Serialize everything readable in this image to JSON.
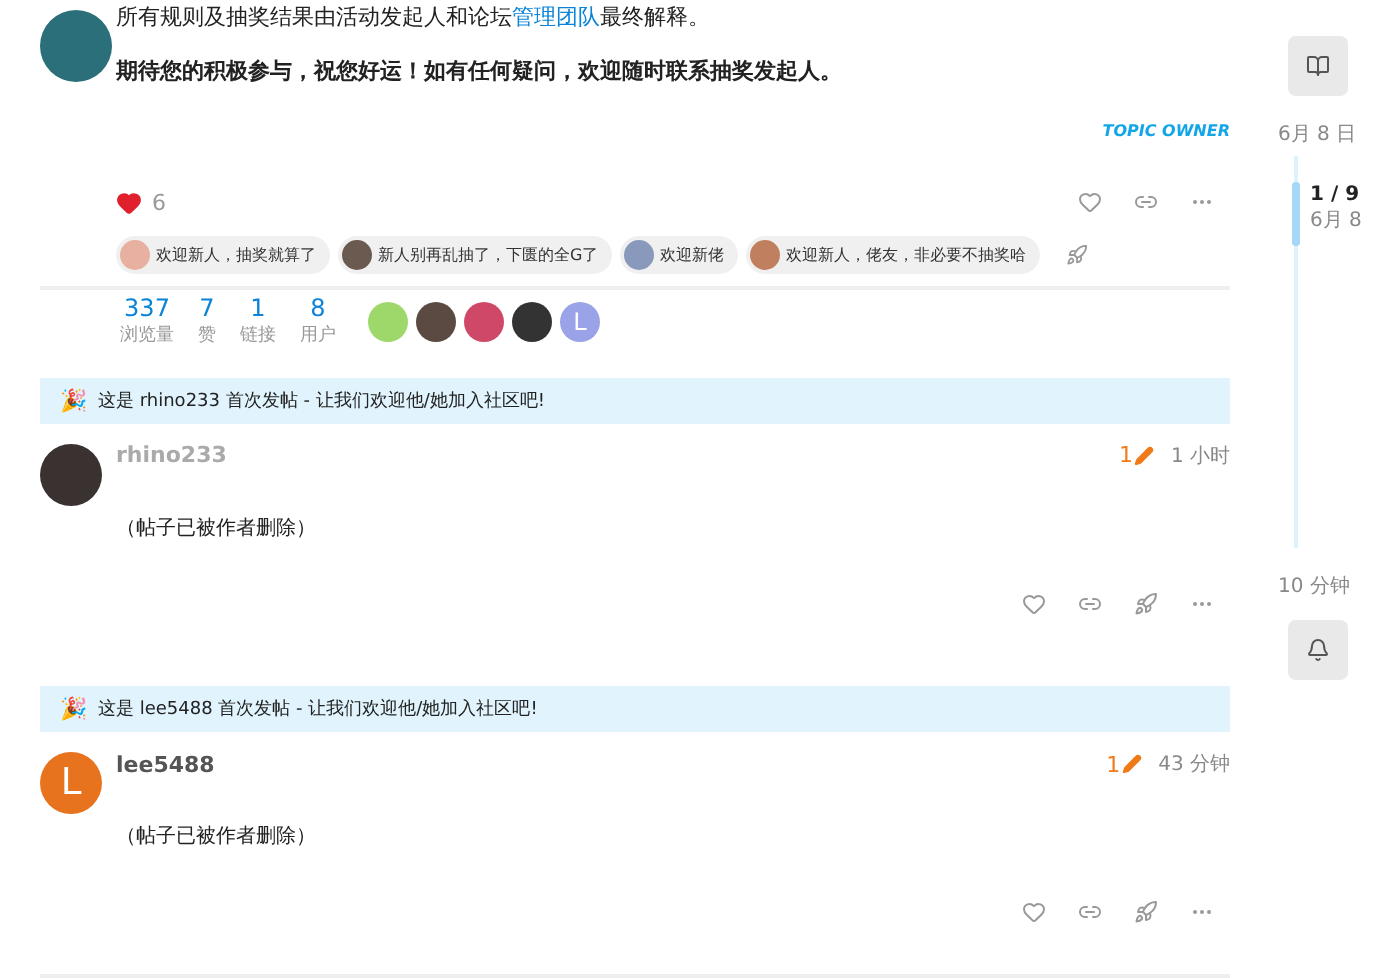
{
  "first_post": {
    "paragraph_1": {
      "before": "所有规则及抽奖结果由活动发起人和论坛",
      "link": "管理团队",
      "after": "最终解释。"
    },
    "paragraph_2": "期待您的积极参与，祝您好运！如有任何疑问，欢迎随时联系抽奖发起人。",
    "badge": "TOPIC OWNER",
    "likes": {
      "count": "6",
      "liked": true
    },
    "reactions": [
      {
        "text": "欢迎新人，抽奖就算了"
      },
      {
        "text": "新人别再乱抽了，下匮的全G了"
      },
      {
        "text": "欢迎新佬"
      },
      {
        "text": "欢迎新人，佬友，非必要不抽奖哈"
      }
    ]
  },
  "stats": [
    {
      "value": "337",
      "label": "浏览量"
    },
    {
      "value": "7",
      "label": "赞"
    },
    {
      "value": "1",
      "label": "链接"
    },
    {
      "value": "8",
      "label": "用户"
    }
  ],
  "participants": [
    {
      "kind": "image"
    },
    {
      "kind": "image"
    },
    {
      "kind": "image"
    },
    {
      "kind": "image"
    },
    {
      "kind": "letter",
      "letter": "L"
    }
  ],
  "posts": [
    {
      "banner_icon": "🎉",
      "banner": "这是 rhino233 首次发帖 - 让我们欢迎他/她加入社区吧!",
      "username": "rhino233",
      "deleted_look": true,
      "avatar": {
        "kind": "image"
      },
      "edits": "1",
      "time": "1 小时",
      "body": "（帖子已被作者删除）"
    },
    {
      "banner_icon": "🎉",
      "banner": "这是 lee5488 首次发帖 - 让我们欢迎他/她加入社区吧!",
      "username": "lee5488",
      "deleted_look": false,
      "avatar": {
        "kind": "letter",
        "letter": "L"
      },
      "edits": "1",
      "time": "43 分钟",
      "body": "（帖子已被作者删除）"
    }
  ],
  "timeline": {
    "start_date": "6月 8 日",
    "position": "1 / 9",
    "position_date": "6月 8",
    "end_label": "10 分钟"
  }
}
